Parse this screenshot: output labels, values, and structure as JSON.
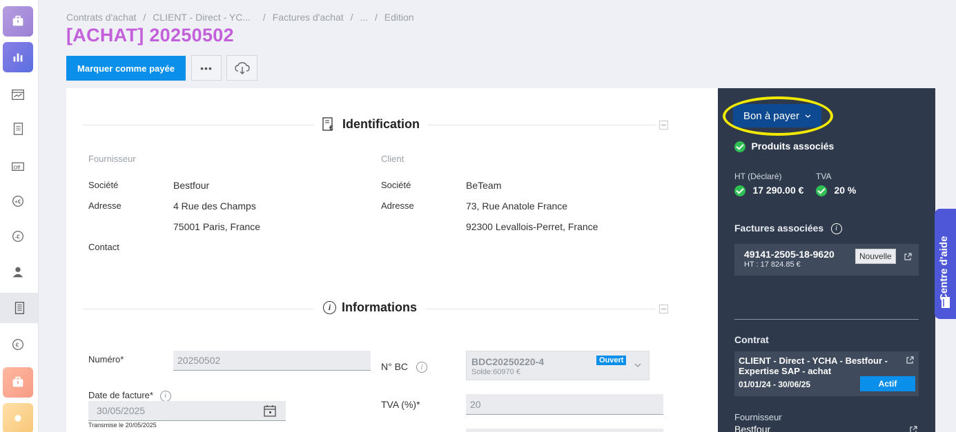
{
  "breadcrumb": {
    "item1": "Contrats d'achat",
    "sep1": "/",
    "item2": "CLIENT - Direct - YC...",
    "sep2": "/",
    "item3": "Factures d'achat",
    "sep3": "/",
    "item4": "...",
    "sep4": "/",
    "item5": "Edition"
  },
  "page_title": "[ACHAT] 20250502",
  "toolbar": {
    "mark_paid_label": "Marquer comme payée",
    "more_label": "•••"
  },
  "identification": {
    "title": "Identification",
    "supplier": {
      "heading": "Fournisseur",
      "company_label": "Société",
      "company_value": "Bestfour",
      "address_label": "Adresse",
      "address_line1": "4 Rue des Champs",
      "address_line2": "75001 Paris, France",
      "contact_label": "Contact"
    },
    "client": {
      "heading": "Client",
      "company_label": "Société",
      "company_value": "BeTeam",
      "address_label": "Adresse",
      "address_line1": "73, Rue Anatole France",
      "address_line2": "92300 Levallois-Perret, France"
    }
  },
  "informations": {
    "title": "Informations",
    "numero_label": "Numéro*",
    "numero_value": "20250502",
    "date_label": "Date de facture*",
    "date_value": "30/05/2025",
    "date_note": "Transmise le 20/05/2025",
    "bc_label": "N° BC",
    "bc_value": "BDC20250220-4",
    "bc_status": "Ouvert",
    "bc_solde": "Solde:60970 €",
    "tva_label": "TVA (%)*",
    "tva_value": "20"
  },
  "panel": {
    "status_button": "Bon à payer",
    "produits_associes": "Produits associés",
    "ht_label": "HT (Déclaré)",
    "ht_value": "17 290.00 €",
    "tva_label": "TVA",
    "tva_value": "20 %",
    "factures_title": "Factures associées",
    "facture": {
      "number": "49141-2505-18-9620",
      "ht": "HT : 17 824.85 €",
      "badge": "Nouvelle"
    },
    "contrat_title": "Contrat",
    "contrat": {
      "name": "CLIENT - Direct - YCHA - Bestfour - Expertise SAP - achat",
      "dates": "01/01/24 - 30/06/25",
      "badge": "Actif"
    },
    "fournisseur_title": "Fournisseur",
    "fournisseur_value": "Bestfour"
  },
  "help_tab": "Centre d'aide",
  "colors": {
    "accent": "#0a8fea",
    "title": "#c45fdc",
    "panel": "#2e3a4c",
    "success": "#2fbf52",
    "highlight": "#f1e900"
  }
}
